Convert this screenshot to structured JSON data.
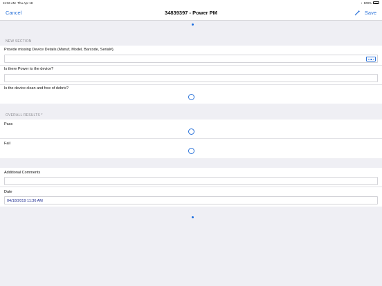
{
  "status_bar": {
    "time": "11:36 AM",
    "date": "Thu Apr 18",
    "battery": "100%"
  },
  "nav": {
    "cancel_label": "Cancel",
    "title": "34839397 - Power PM",
    "save_label": "Save"
  },
  "sections": {
    "new_section": {
      "header": "NEW SECTION",
      "device_details_label": "Provide missing Device Details (Manuf, Model, Barcode, Serial#).",
      "power_label": "Is there Power to the device?",
      "clean_label": "Is the device clean and free of debris?"
    },
    "overall_results": {
      "header": "OVERALL RESULTS *",
      "pass_label": "Pass",
      "fail_label": "Fail"
    },
    "comments": {
      "additional_comments_label": "Additional Comments",
      "date_label": "Date",
      "date_value": "04/18/2019 11:36 AM"
    }
  },
  "icons": {
    "barcode": "barcode-scan-icon",
    "wand": "magic-wand-icon",
    "radio": "radio-unselected-icon"
  },
  "colors": {
    "accent": "#2a72d9",
    "background": "#efeff4",
    "date_text": "#1b2a8f"
  }
}
